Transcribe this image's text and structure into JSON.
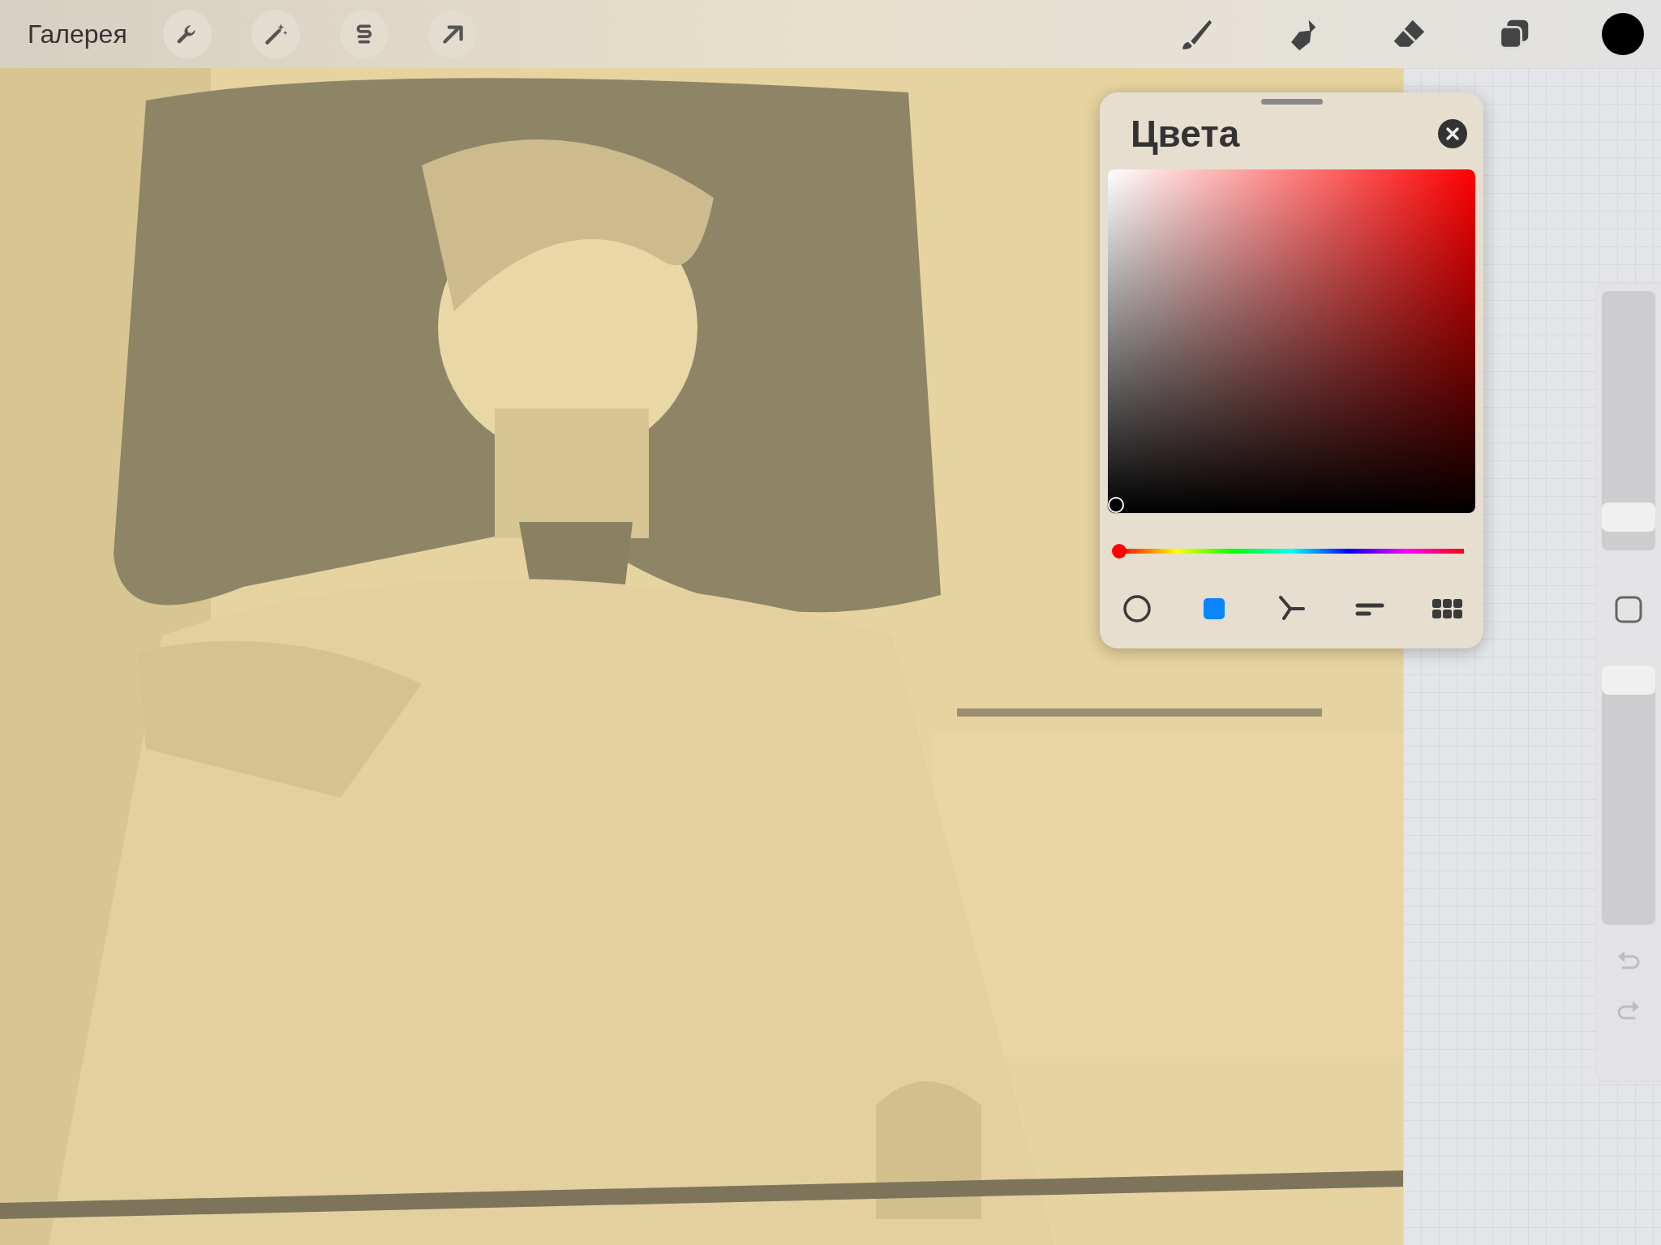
{
  "top_bar": {
    "gallery_button": "Галерея"
  },
  "color_panel": {
    "title": "Цвета",
    "saturation_brightness": {
      "level": 0
    },
    "hue_slider": {
      "level": 0
    },
    "tabs": [
      {
        "kind": "disc",
        "selected": false
      },
      {
        "kind": "classic",
        "selected": true
      },
      {
        "kind": "harmony",
        "selected": false
      },
      {
        "kind": "value",
        "selected": false
      },
      {
        "kind": "palettes",
        "selected": false
      }
    ]
  },
  "side_bar": {
    "size_slider": {
      "level": 0.08
    },
    "opacity_slider": {
      "level": 1
    },
    "undo": {
      "disabled": true
    },
    "redo": {
      "disabled": true
    }
  }
}
